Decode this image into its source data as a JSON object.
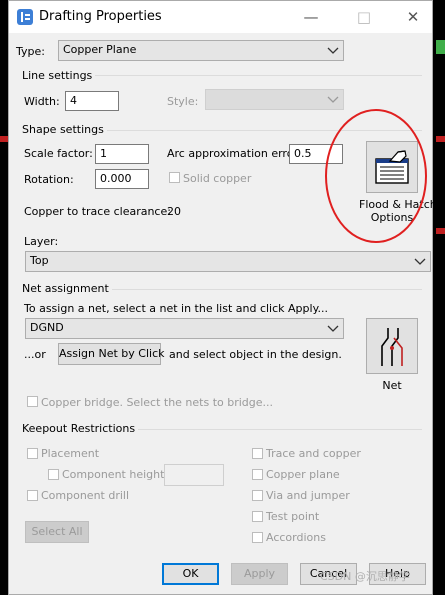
{
  "window": {
    "title": "Drafting Properties",
    "minimize": "—",
    "maximize": "□",
    "close": "✕"
  },
  "type": {
    "label": "Type:",
    "value": "Copper Plane"
  },
  "line_settings": {
    "title": "Line settings",
    "width_label": "Width:",
    "width_value": "4",
    "style_label": "Style:",
    "style_value": ""
  },
  "shape_settings": {
    "title": "Shape settings",
    "scale_label": "Scale factor:",
    "scale_value": "1",
    "arc_label": "Arc approximation error:",
    "arc_value": "0.5",
    "rotation_label": "Rotation:",
    "rotation_value": "0.000",
    "solid_copper_label": "Solid copper",
    "clearance_label": "Copper to trace clearance:",
    "clearance_value": "20",
    "flood_button_label_1": "Flood & Hatch",
    "flood_button_label_2": "Options"
  },
  "layer": {
    "label": "Layer:",
    "value": "Top"
  },
  "net_assignment": {
    "title": "Net assignment",
    "instruction": "To assign a net, select a net in the list and click Apply...",
    "net_value": "DGND",
    "or_text": "...or",
    "assign_button": "Assign Net by Click",
    "after_text": "and select object in the design.",
    "net_button_label": "Net"
  },
  "copper_bridge": {
    "label": "Copper bridge. Select the nets to bridge..."
  },
  "keepout": {
    "title": "Keepout Restrictions",
    "placement": "Placement",
    "component_height": "Component height",
    "component_drill": "Component drill",
    "select_all": "Select All",
    "trace_and_copper": "Trace and copper",
    "copper_plane": "Copper plane",
    "via_and_jumper": "Via and jumper",
    "test_point": "Test point",
    "accordions": "Accordions"
  },
  "footer": {
    "ok": "OK",
    "apply": "Apply",
    "cancel": "Cancel",
    "help": "Help"
  },
  "watermark": "CSDN @沉思静学",
  "colors": {
    "accent": "#0078d7",
    "annotation": "#e02020",
    "background": "#f0f0f0"
  },
  "icons": [
    "app-icon",
    "chevron-down-icon",
    "hatch-hand-icon",
    "net-trace-icon"
  ]
}
